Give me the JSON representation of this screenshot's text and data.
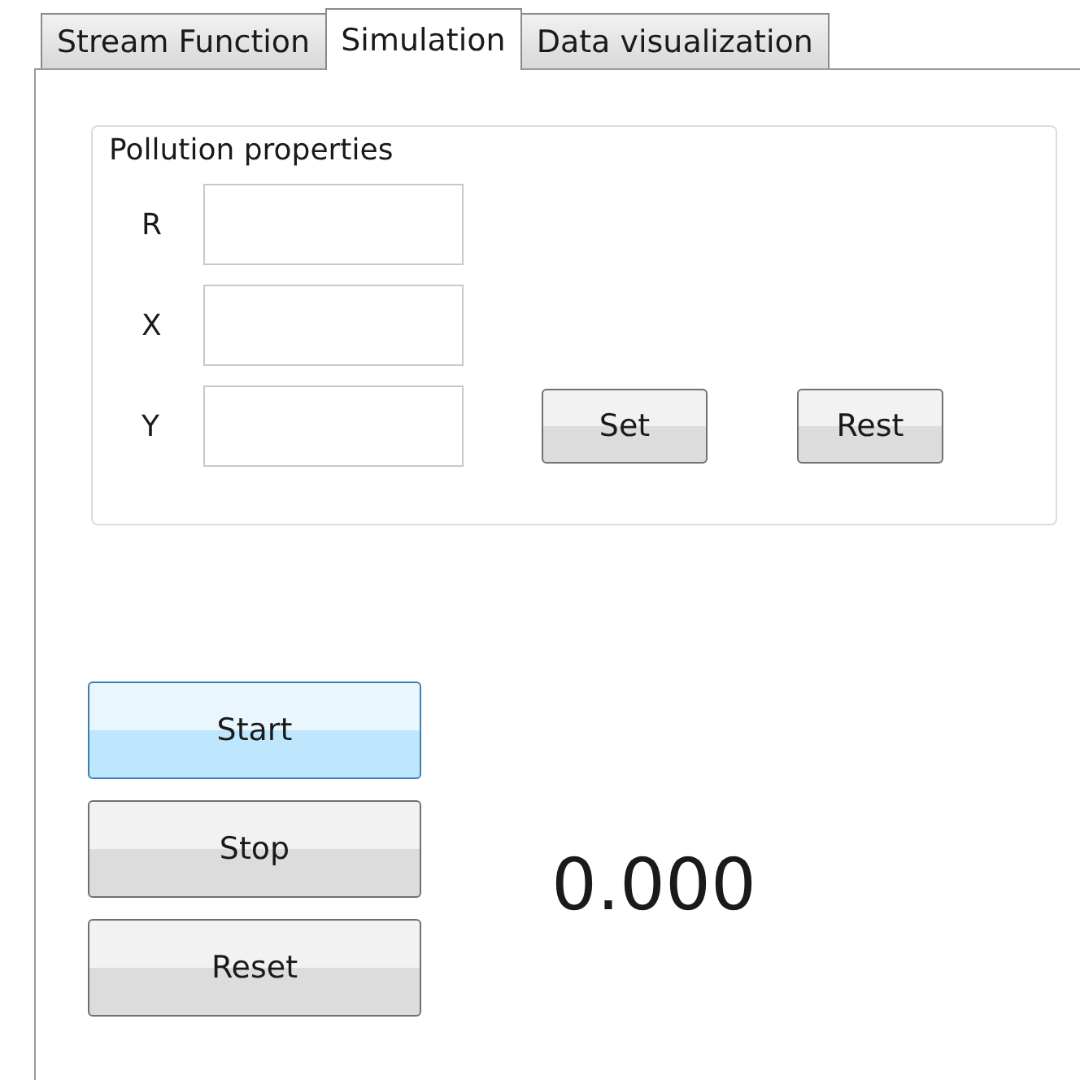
{
  "tabs": [
    {
      "label": "Stream Function",
      "selected": false
    },
    {
      "label": "Simulation",
      "selected": true
    },
    {
      "label": "Data visualization",
      "selected": false
    }
  ],
  "pollution_properties": {
    "title": "Pollution properties",
    "fields": [
      {
        "label": "R"
      },
      {
        "label": "X"
      },
      {
        "label": "Y"
      }
    ],
    "buttons": [
      "Set",
      "Rest"
    ]
  },
  "controls": [
    {
      "label": "Start",
      "highlighted": true
    },
    {
      "label": "Stop",
      "highlighted": false
    },
    {
      "label": "Reset",
      "highlighted": false
    }
  ],
  "reading": "0.000"
}
